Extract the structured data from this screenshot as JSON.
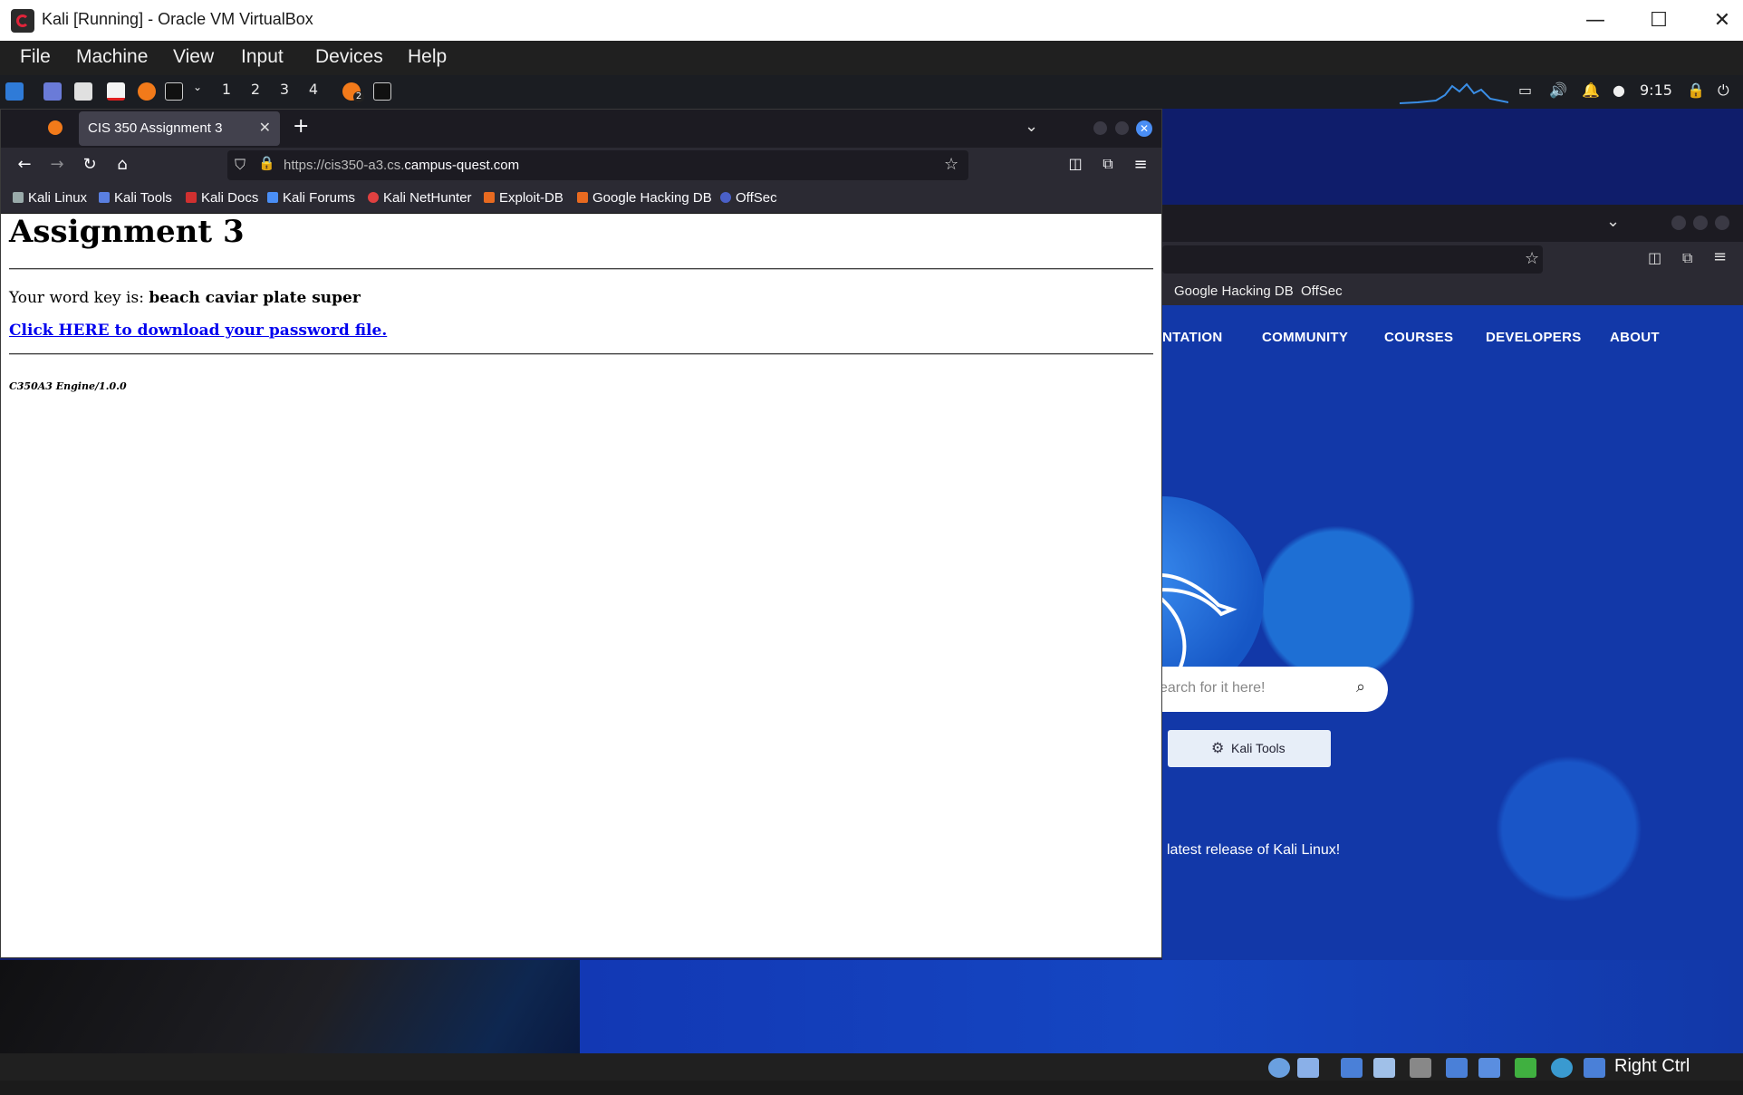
{
  "host": {
    "title": "Kali [Running] - Oracle VM VirtualBox",
    "menu": [
      "File",
      "Machine",
      "View",
      "Input",
      "Devices",
      "Help"
    ],
    "minimize": "—",
    "maximize": "☐",
    "close": "✕",
    "status_right": "Right Ctrl"
  },
  "panel": {
    "workspaces": [
      "1",
      "2",
      "3",
      "4"
    ],
    "badge": "2",
    "clock": "9:15"
  },
  "browser": {
    "tab_title": "CIS 350 Assignment 3",
    "tab_close": "✕",
    "new_tab": "+",
    "url_prefix": "https://cis350-a3.cs.",
    "url_domain": "campus-quest.com",
    "bookmarks": [
      "Kali Linux",
      "Kali Tools",
      "Kali Docs",
      "Kali Forums",
      "Kali NetHunter",
      "Exploit-DB",
      "Google Hacking DB",
      "OffSec"
    ]
  },
  "page": {
    "heading": "Assignment 3",
    "word_key_label": "Your word key is: ",
    "word_key_value": "beach caviar plate super",
    "download_link": "Click HERE to download your password file.",
    "engine": "C350A3 Engine/1.0.0"
  },
  "background_browser": {
    "bookmarks": [
      "Google Hacking DB",
      "OffSec"
    ],
    "nav": [
      "NTATION",
      "COMMUNITY",
      "COURSES",
      "DEVELOPERS",
      "ABOUT"
    ],
    "search_placeholder": "earch for it here!",
    "tools_button": "Kali Tools",
    "latest_text": " latest release of Kali Linux!"
  }
}
